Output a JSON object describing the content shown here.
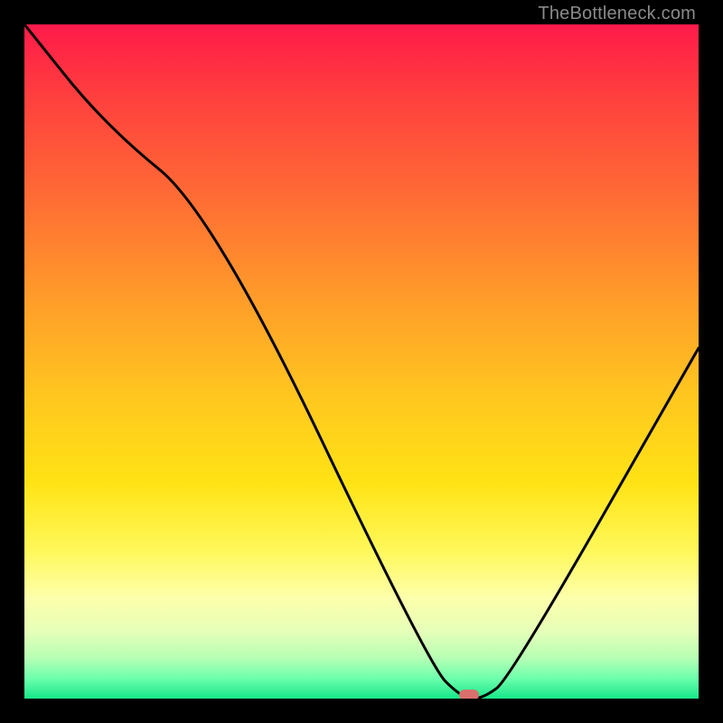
{
  "watermark": "TheBottleneck.com",
  "chart_data": {
    "type": "line",
    "title": "",
    "xlabel": "",
    "ylabel": "",
    "xlim": [
      0,
      100
    ],
    "ylim": [
      0,
      100
    ],
    "background": "heatmap-gradient-red-yellow-green",
    "series": [
      {
        "name": "bottleneck-curve",
        "x": [
          0,
          12,
          28,
          60,
          65,
          68,
          72,
          100
        ],
        "values": [
          100,
          85,
          72,
          5,
          0,
          0,
          3,
          52
        ]
      }
    ],
    "marker": {
      "x": 66,
      "y": 0.5,
      "color": "#d9706d"
    },
    "gradient_stops": [
      {
        "pos": 0.0,
        "color": "#ff1a4a"
      },
      {
        "pos": 0.1,
        "color": "#ff3d3f"
      },
      {
        "pos": 0.25,
        "color": "#ff6a35"
      },
      {
        "pos": 0.4,
        "color": "#ff9a2a"
      },
      {
        "pos": 0.55,
        "color": "#ffc61f"
      },
      {
        "pos": 0.68,
        "color": "#ffe315"
      },
      {
        "pos": 0.78,
        "color": "#fff85a"
      },
      {
        "pos": 0.85,
        "color": "#fdffaa"
      },
      {
        "pos": 0.9,
        "color": "#e6ffb8"
      },
      {
        "pos": 0.94,
        "color": "#b6ffb4"
      },
      {
        "pos": 0.97,
        "color": "#6dffad"
      },
      {
        "pos": 1.0,
        "color": "#17e68a"
      }
    ]
  }
}
